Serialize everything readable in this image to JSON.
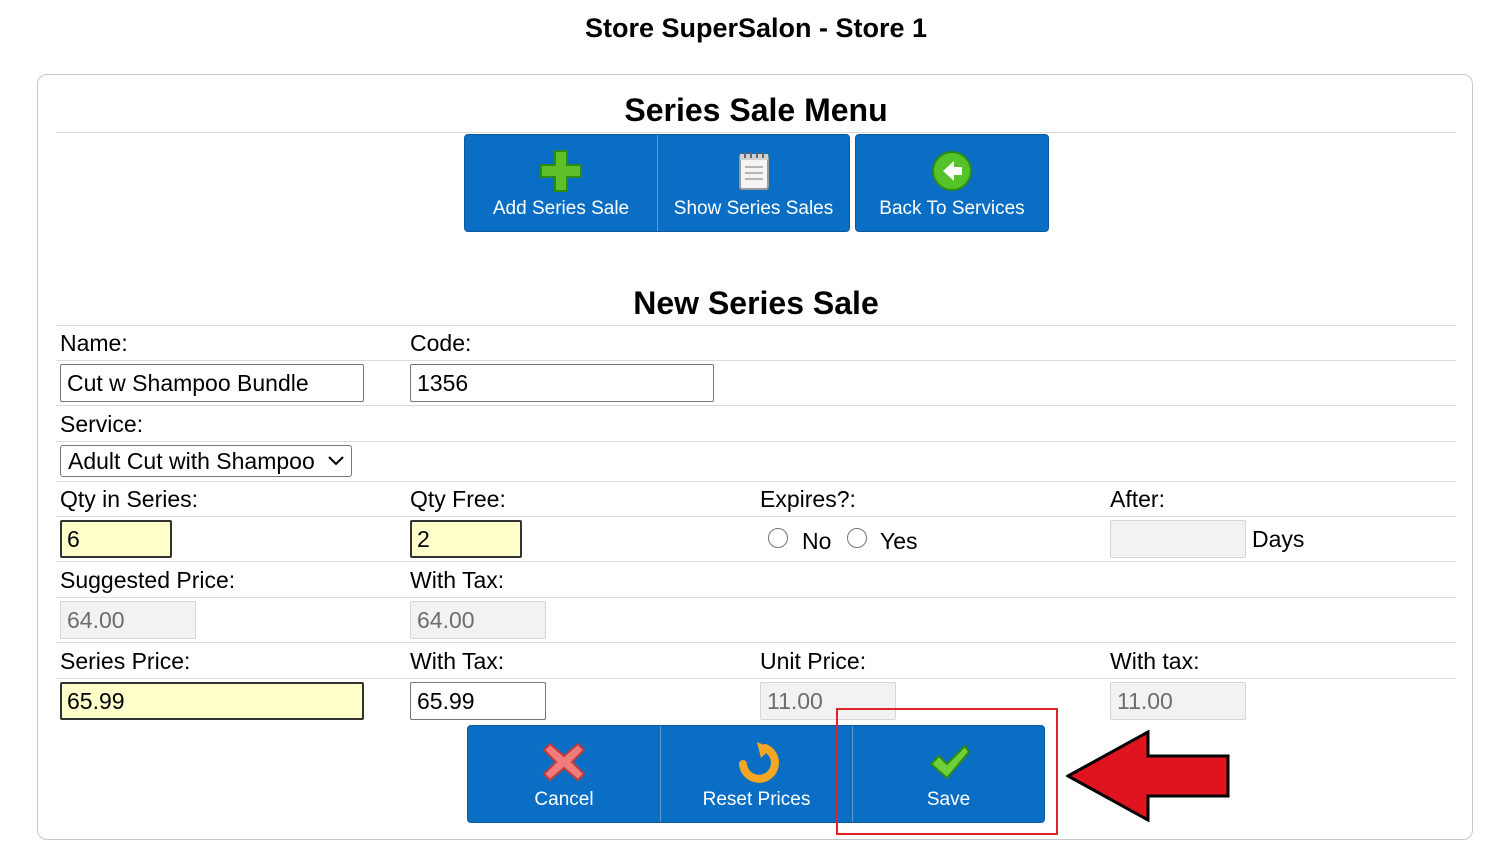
{
  "store_title": "Store SuperSalon - Store 1",
  "menu": {
    "title": "Series Sale Menu",
    "buttons": [
      {
        "label": "Add Series Sale",
        "icon": "plus-icon"
      },
      {
        "label": "Show Series Sales",
        "icon": "notepad-icon"
      },
      {
        "label": "Back To Services",
        "icon": "back-arrow-icon"
      }
    ]
  },
  "form": {
    "title": "New Series Sale",
    "name_label": "Name:",
    "name_value": "Cut w Shampoo Bundle",
    "code_label": "Code:",
    "code_value": "1356",
    "service_label": "Service:",
    "service_value": "Adult Cut with Shampoo",
    "qty_series_label": "Qty in Series:",
    "qty_series_value": "6",
    "qty_free_label": "Qty Free:",
    "qty_free_value": "2",
    "expires_label": "Expires?:",
    "expires_no": "No",
    "expires_yes": "Yes",
    "after_label": "After:",
    "after_value": "",
    "days_label": "Days",
    "suggested_price_label": "Suggested Price:",
    "suggested_price_value": "64.00",
    "suggested_tax_label": "With Tax:",
    "suggested_tax_value": "64.00",
    "series_price_label": "Series Price:",
    "series_price_value": "65.99",
    "series_tax_label": "With Tax:",
    "series_tax_value": "65.99",
    "unit_price_label": "Unit Price:",
    "unit_price_value": "11.00",
    "unit_tax_label": "With tax:",
    "unit_tax_value": "11.00"
  },
  "actions": [
    {
      "label": "Cancel",
      "icon": "cancel-x-icon"
    },
    {
      "label": "Reset Prices",
      "icon": "reset-arrow-icon"
    },
    {
      "label": "Save",
      "icon": "checkmark-icon"
    }
  ],
  "colors": {
    "button_blue": "#0a6fc4",
    "highlight_yellow": "#ffffcc",
    "annotation_red": "#e0222b"
  }
}
